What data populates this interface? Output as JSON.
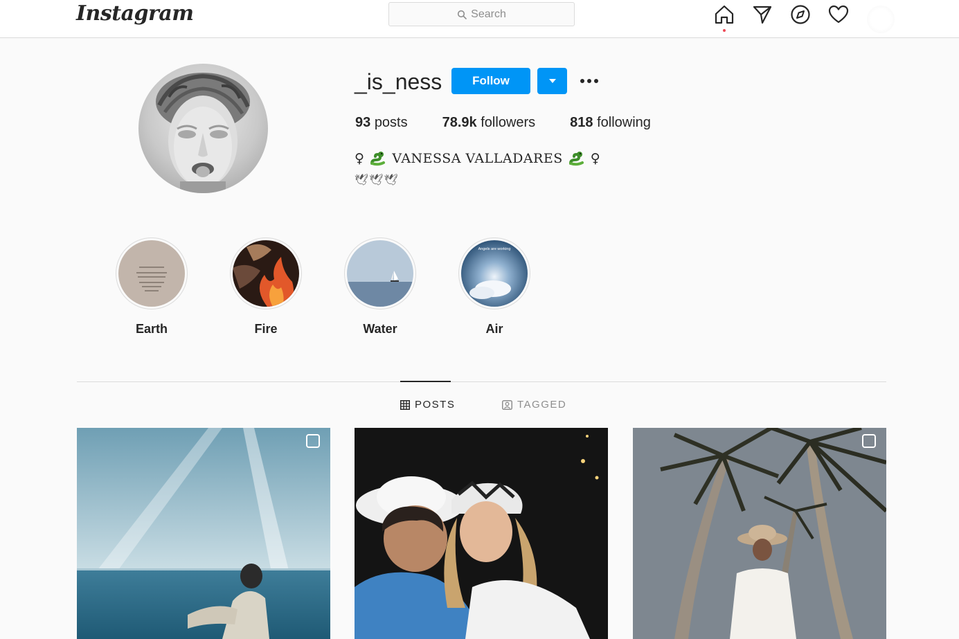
{
  "nav": {
    "logo": "Instagram",
    "search_placeholder": "Search",
    "icons": [
      "home-icon",
      "direct-icon",
      "explore-icon",
      "activity-heart-icon"
    ]
  },
  "profile": {
    "username": "_is_ness",
    "follow_label": "Follow",
    "stats": {
      "posts_count": "93",
      "posts_label": "posts",
      "followers_count": "78.9k",
      "followers_label": "followers",
      "following_count": "818",
      "following_label": "following"
    },
    "bio_symbol": "♀",
    "bio_name": "VANESSA VALLADARES",
    "bio_line2": "🕊🕊🕊"
  },
  "highlights": [
    {
      "label": "Earth"
    },
    {
      "label": "Fire"
    },
    {
      "label": "Water"
    },
    {
      "label": "Air"
    }
  ],
  "highlight_air_caption": "Angels are working",
  "tabs": {
    "posts": "POSTS",
    "tagged": "TAGGED"
  },
  "colors": {
    "accent": "#0095f6",
    "background": "#fafafa",
    "border": "#dbdbdb",
    "text": "#262626",
    "muted": "#8e8e8e",
    "notification": "#ed4956"
  }
}
